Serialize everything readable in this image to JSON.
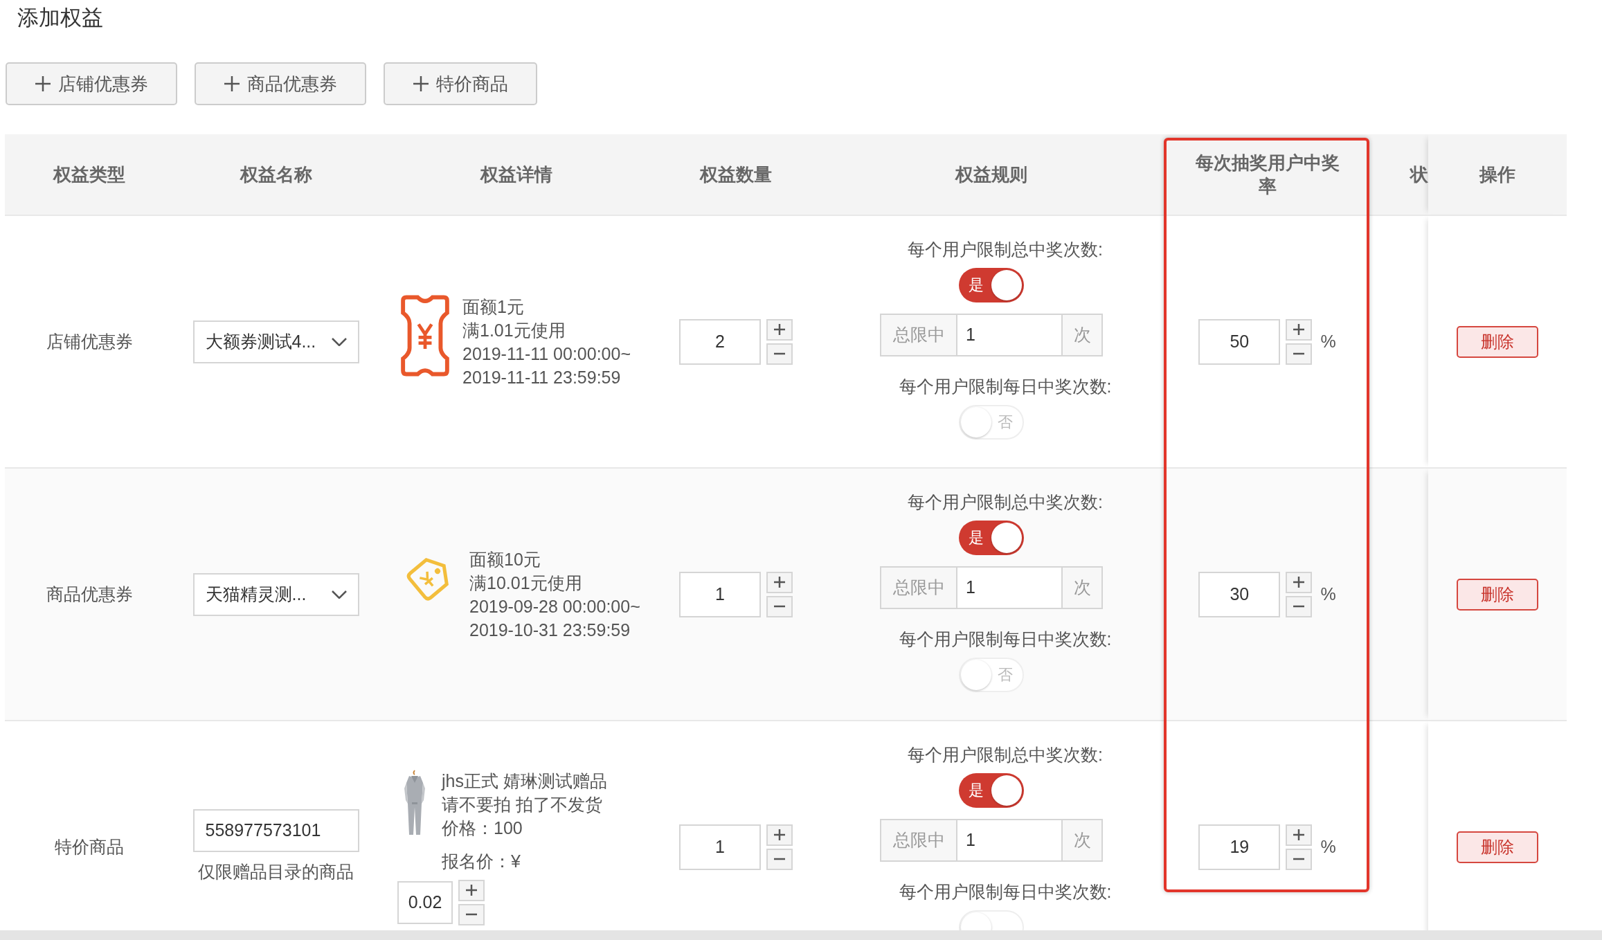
{
  "title": "添加权益",
  "add_buttons": [
    {
      "label": "店铺优惠券"
    },
    {
      "label": "商品优惠券"
    },
    {
      "label": "特价商品"
    }
  ],
  "table": {
    "columns": [
      {
        "label": "权益类型",
        "highlighted": false
      },
      {
        "label": "权益名称",
        "highlighted": false
      },
      {
        "label": "权益详情",
        "highlighted": false
      },
      {
        "label": "权益数量",
        "highlighted": false
      },
      {
        "label": "权益规则",
        "highlighted": false
      },
      {
        "label": "每次抽奖用户中奖率",
        "highlighted": true
      },
      {
        "label": "状",
        "highlighted": false
      },
      {
        "label": "操作",
        "highlighted": false
      }
    ],
    "rows": [
      {
        "type": "店铺优惠券",
        "name": {
          "kind": "select",
          "value": "大额券测试4..."
        },
        "detail": {
          "kind": "ticket",
          "lines": [
            "面额1元",
            "满1.01元使用",
            "2019-11-11 00:00:00~",
            "2019-11-11 23:59:59"
          ]
        },
        "quantity": "2",
        "rules": {
          "total": {
            "label": "每个用户限制总中奖次数:",
            "toggle": {
              "on": true,
              "text": "是"
            },
            "limit": {
              "prefix": "总限中",
              "value": "1",
              "suffix": "次"
            }
          },
          "daily": {
            "label": "每个用户限制每日中奖次数:",
            "toggle": {
              "on": false,
              "text": "否"
            }
          }
        },
        "rate": "50",
        "rate_unit": "%",
        "action": "删除"
      },
      {
        "type": "商品优惠券",
        "name": {
          "kind": "select",
          "value": "天猫精灵测..."
        },
        "detail": {
          "kind": "tag",
          "lines": [
            "面额10元",
            "满10.01元使用",
            "2019-09-28 00:00:00~",
            "2019-10-31 23:59:59"
          ]
        },
        "quantity": "1",
        "rules": {
          "total": {
            "label": "每个用户限制总中奖次数:",
            "toggle": {
              "on": true,
              "text": "是"
            },
            "limit": {
              "prefix": "总限中",
              "value": "1",
              "suffix": "次"
            }
          },
          "daily": {
            "label": "每个用户限制每日中奖次数:",
            "toggle": {
              "on": false,
              "text": "否"
            }
          }
        },
        "rate": "30",
        "rate_unit": "%",
        "action": "删除"
      },
      {
        "type": "特价商品",
        "name": {
          "kind": "input",
          "value": "558977573101",
          "note": "仅限赠品目录的商品"
        },
        "detail": {
          "kind": "picture",
          "lines": [
            "jhs正式 婧琳测试赠品",
            "请不要拍 拍了不发货",
            "价格：100"
          ],
          "price_label": "报名价：¥",
          "price_value": "0.02"
        },
        "quantity": "1",
        "rules": {
          "total": {
            "label": "每个用户限制总中奖次数:",
            "toggle": {
              "on": true,
              "text": "是"
            },
            "limit": {
              "prefix": "总限中",
              "value": "1",
              "suffix": "次"
            }
          },
          "daily": {
            "label": "每个用户限制每日中奖次数:",
            "toggle": {
              "on": false
            }
          }
        },
        "rate": "19",
        "rate_unit": "%",
        "action": "删除"
      }
    ]
  }
}
